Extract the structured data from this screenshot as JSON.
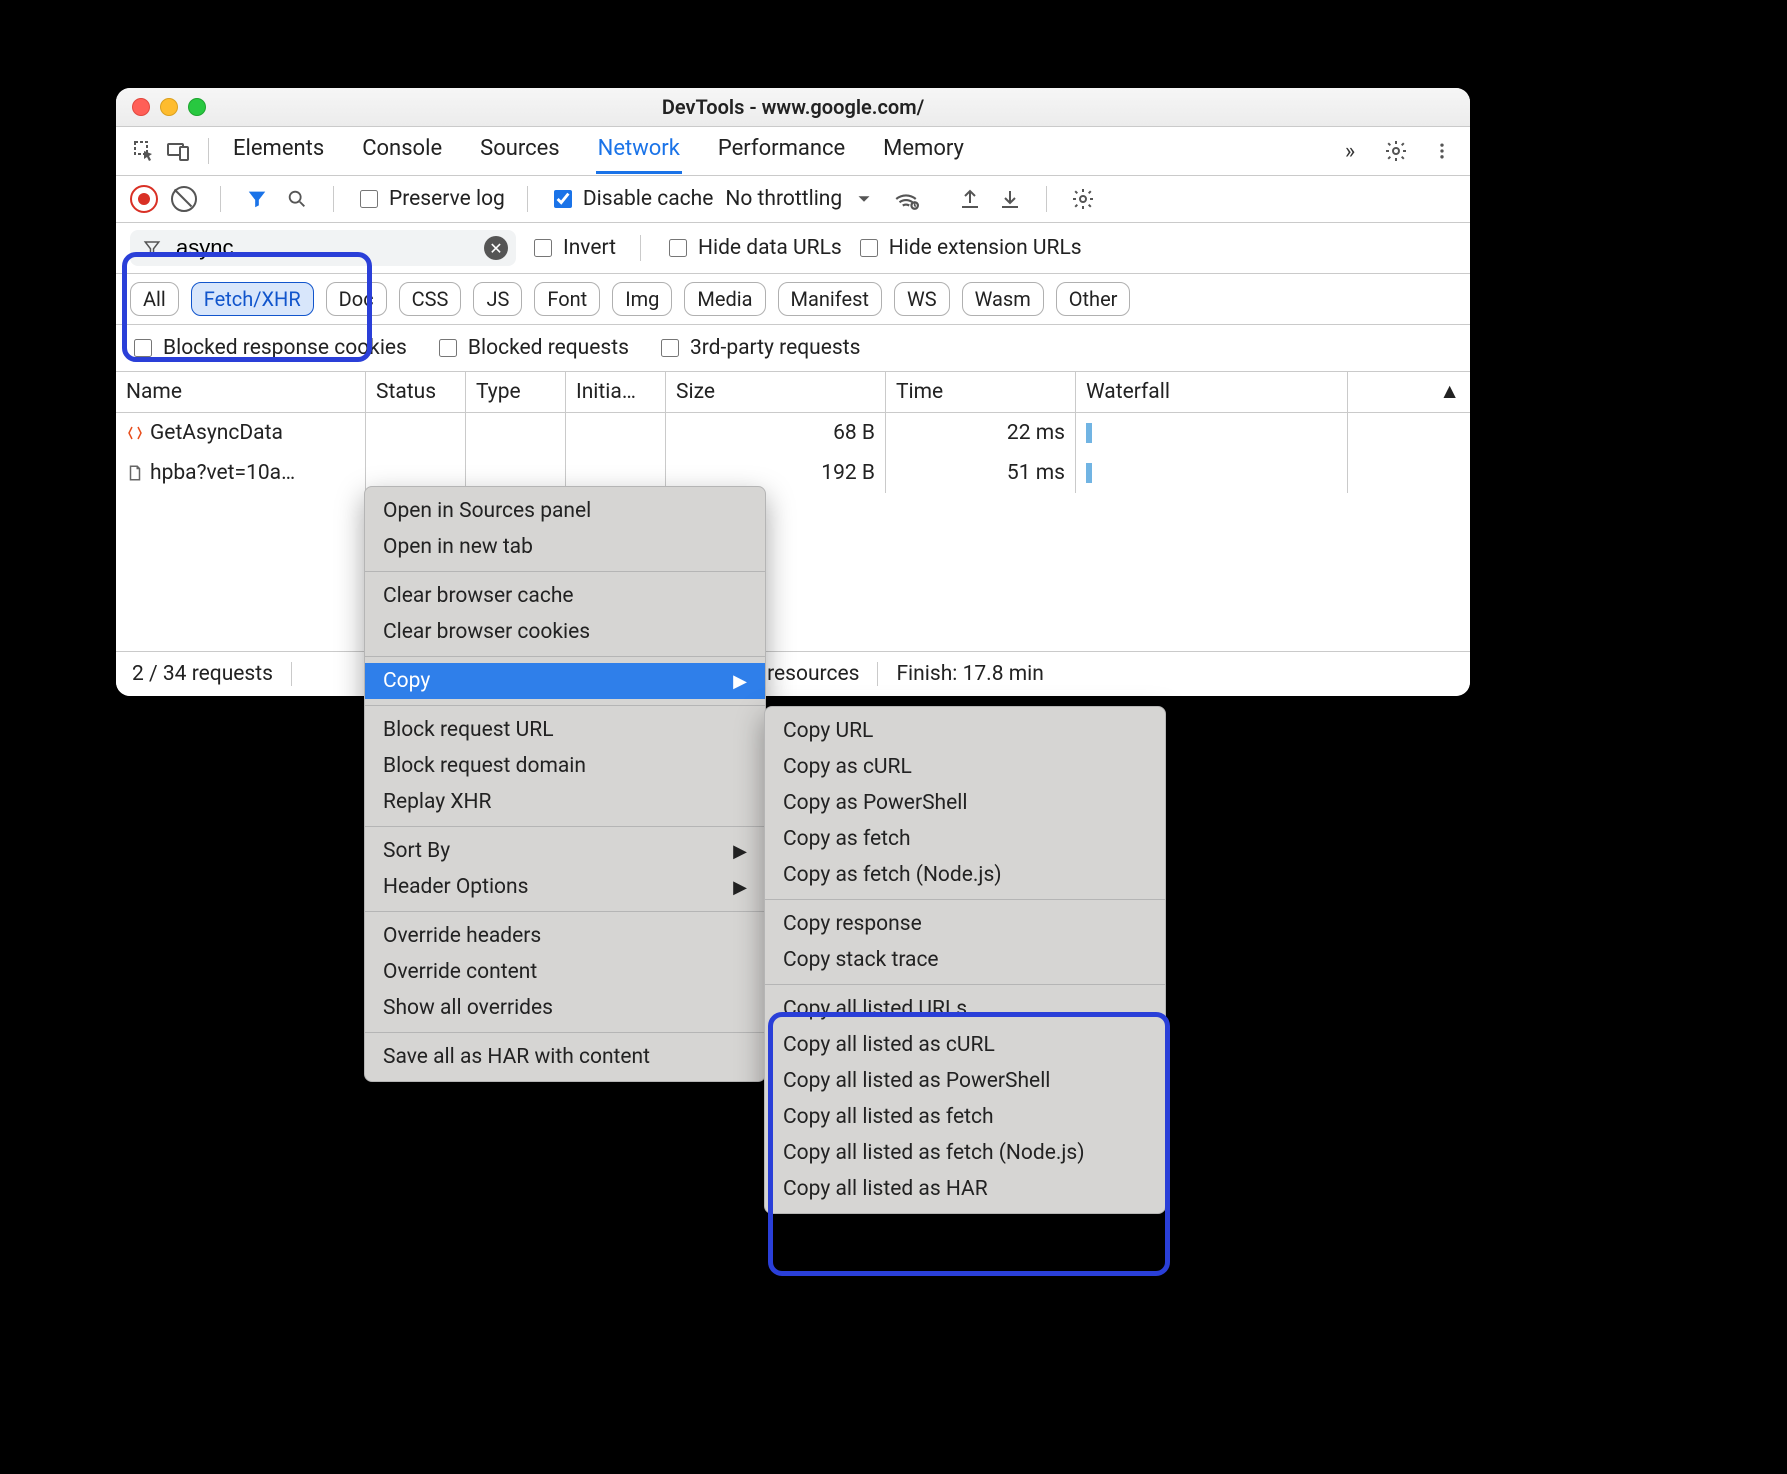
{
  "window": {
    "title": "DevTools - www.google.com/"
  },
  "tabs": {
    "items": [
      "Elements",
      "Console",
      "Sources",
      "Network",
      "Performance",
      "Memory"
    ],
    "active": "Network",
    "overflow": "»"
  },
  "toolbar": {
    "preserve_label": "Preserve log",
    "preserve_checked": false,
    "disable_cache_label": "Disable cache",
    "disable_cache_checked": true,
    "throttling_label": "No throttling"
  },
  "filter": {
    "value": "async",
    "invert_label": "Invert",
    "invert_checked": false,
    "hide_data_label": "Hide data URLs",
    "hide_data_checked": false,
    "hide_ext_label": "Hide extension URLs",
    "hide_ext_checked": false,
    "types": [
      "All",
      "Fetch/XHR",
      "Doc",
      "CSS",
      "JS",
      "Font",
      "Img",
      "Media",
      "Manifest",
      "WS",
      "Wasm",
      "Other"
    ],
    "type_selected": "Fetch/XHR",
    "blocked_cookies_label": "Blocked response cookies",
    "blocked_requests_label": "Blocked requests",
    "third_party_label": "3rd-party requests"
  },
  "columns": {
    "name": "Name",
    "status": "Status",
    "type": "Type",
    "initiator": "Initia…",
    "size": "Size",
    "time": "Time",
    "waterfall": "Waterfall"
  },
  "rows": [
    {
      "name": "GetAsyncData",
      "status": "",
      "type": "",
      "initiator": "",
      "size": "68 B",
      "time": "22 ms",
      "icon": "fetch"
    },
    {
      "name": "hpba?vet=10a…",
      "status": "",
      "type": "",
      "initiator": "",
      "size": "192 B",
      "time": "51 ms",
      "icon": "doc"
    }
  ],
  "status": {
    "requests": "2 / 34 requests",
    "transferred": "5 B / 2.4 MB resources",
    "finish": "Finish: 17.8 min"
  },
  "ctx1": {
    "g1": [
      "Open in Sources panel",
      "Open in new tab"
    ],
    "g2": [
      "Clear browser cache",
      "Clear browser cookies"
    ],
    "copy": "Copy",
    "g3": [
      "Block request URL",
      "Block request domain",
      "Replay XHR"
    ],
    "g4": [
      "Sort By",
      "Header Options"
    ],
    "g5": [
      "Override headers",
      "Override content",
      "Show all overrides"
    ],
    "g6": [
      "Save all as HAR with content"
    ]
  },
  "ctx2": {
    "g1": [
      "Copy URL",
      "Copy as cURL",
      "Copy as PowerShell",
      "Copy as fetch",
      "Copy as fetch (Node.js)"
    ],
    "g2": [
      "Copy response",
      "Copy stack trace"
    ],
    "g3": [
      "Copy all listed URLs",
      "Copy all listed as cURL",
      "Copy all listed as PowerShell",
      "Copy all listed as fetch",
      "Copy all listed as fetch (Node.js)",
      "Copy all listed as HAR"
    ]
  }
}
